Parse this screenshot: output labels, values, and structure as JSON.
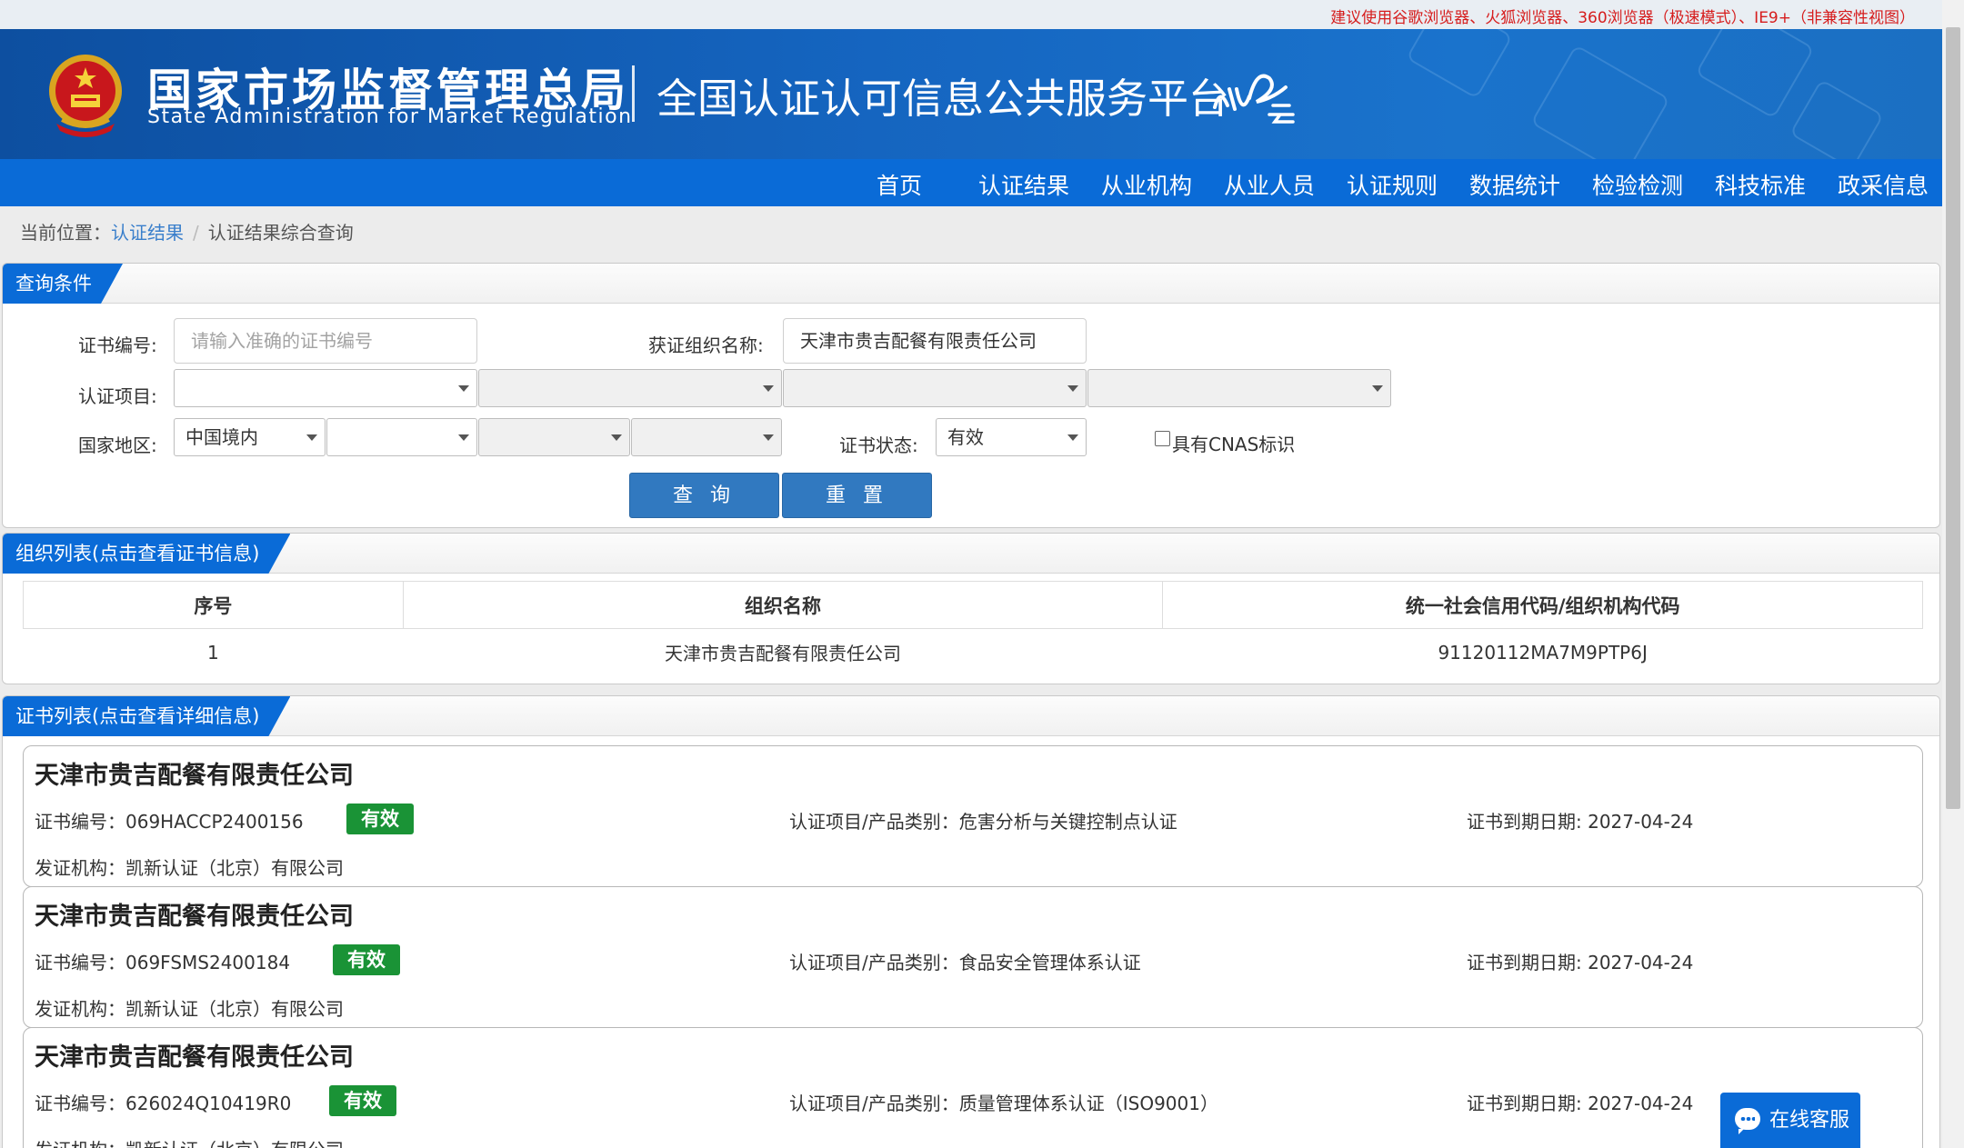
{
  "top_tip": "建议使用谷歌浏览器、火狐浏览器、360浏览器（极速模式）、IE9+（非兼容性视图）",
  "header": {
    "org_name_cn": "国家市场监督管理总局",
    "org_name_en": "State Administration  for  Market Regulation",
    "platform_title": "全国认证认可信息公共服务平台"
  },
  "nav": [
    "首页",
    "认证结果",
    "从业机构",
    "从业人员",
    "认证规则",
    "数据统计",
    "检验检测",
    "科技标准",
    "政采信息"
  ],
  "breadcrumb": {
    "prefix": "当前位置：",
    "link": "认证结果",
    "sep": "/",
    "current": "认证结果综合查询"
  },
  "query": {
    "title": "查询条件",
    "cert_no_label": "证书编号:",
    "cert_no_placeholder": "请输入准确的证书编号",
    "org_name_label": "获证组织名称:",
    "org_name_value": "天津市贵吉配餐有限责任公司",
    "project_label": "认证项目:",
    "region_label": "国家地区:",
    "region_value": "中国境内",
    "status_label": "证书状态:",
    "status_value": "有效",
    "cnas_label": "具有CNAS标识",
    "search_button": "查 询",
    "reset_button": "重 置"
  },
  "org_list": {
    "title": "组织列表(点击查看证书信息)",
    "columns": [
      "序号",
      "组织名称",
      "统一社会信用代码/组织机构代码"
    ],
    "rows": [
      [
        "1",
        "天津市贵吉配餐有限责任公司",
        "91120112MA7M9PTP6J"
      ]
    ]
  },
  "cert_list": {
    "title": "证书列表(点击查看详细信息)",
    "items": [
      {
        "org": "天津市贵吉配餐有限责任公司",
        "cert_no": "证书编号：069HACCP2400156",
        "status": "有效",
        "project": "认证项目/产品类别：危害分析与关键控制点认证",
        "expiry": "证书到期日期: 2027-04-24",
        "issuer": "发证机构：凯新认证（北京）有限公司"
      },
      {
        "org": "天津市贵吉配餐有限责任公司",
        "cert_no": "证书编号：069FSMS2400184",
        "status": "有效",
        "project": "认证项目/产品类别：食品安全管理体系认证",
        "expiry": "证书到期日期: 2027-04-24",
        "issuer": "发证机构：凯新认证（北京）有限公司"
      },
      {
        "org": "天津市贵吉配餐有限责任公司",
        "cert_no": "证书编号：626024Q10419R0",
        "status": "有效",
        "project": "认证项目/产品类别：质量管理体系认证（ISO9001）",
        "expiry": "证书到期日期: 2027-04-24",
        "issuer": "发证机构：凯新认证（北京）有限公司"
      }
    ]
  },
  "online_service": "在线客服",
  "colors": {
    "brand_blue": "#0a6bd7",
    "valid_green": "#1a9336",
    "tip_red": "#d61d1d"
  }
}
